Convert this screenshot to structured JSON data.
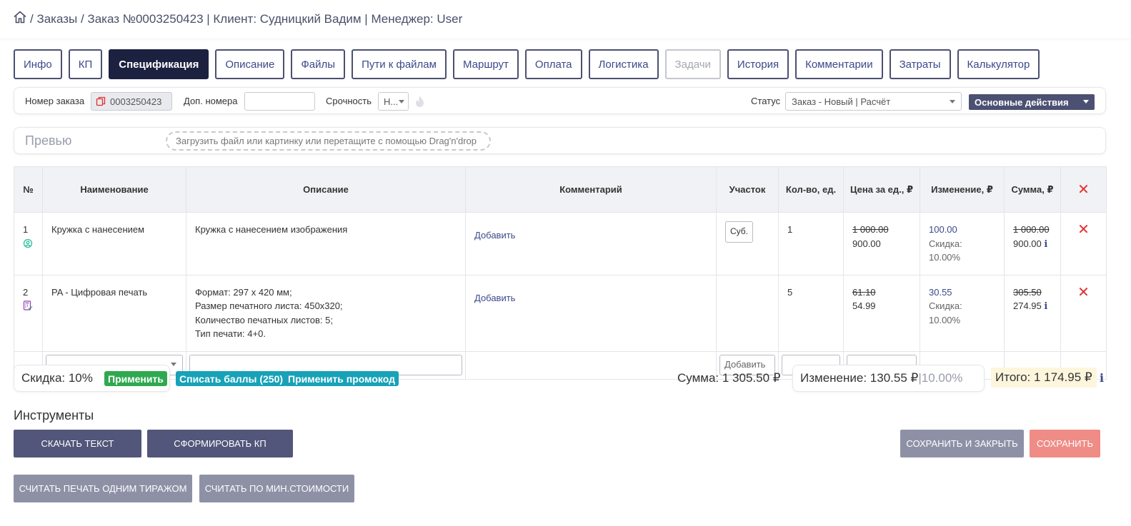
{
  "breadcrumb": {
    "text": " / Заказы / Заказ №0003250423 | Клиент: Судницкий Вадим | Менеджер: User"
  },
  "tabs": [
    {
      "label": "Инфо"
    },
    {
      "label": "КП"
    },
    {
      "label": "Спецификация"
    },
    {
      "label": "Описание"
    },
    {
      "label": "Файлы"
    },
    {
      "label": "Пути к файлам"
    },
    {
      "label": "Маршрут"
    },
    {
      "label": "Оплата"
    },
    {
      "label": "Логистика"
    },
    {
      "label": "Задачи"
    },
    {
      "label": "История"
    },
    {
      "label": "Комментарии"
    },
    {
      "label": "Затраты"
    },
    {
      "label": "Калькулятор"
    }
  ],
  "order": {
    "number_label": "Номер заказа",
    "number_value": "0003250423",
    "extra_label": "Доп. номера",
    "extra_value": "",
    "urgency_label": "Срочность",
    "urgency_value": "Н...",
    "status_label": "Статус",
    "status_value": "Заказ - Новый | Расчёт",
    "actions_label": "Основные действия"
  },
  "preview": {
    "title": "Превью",
    "dropzone": "Загрузить файл или картинку или перетащите с помощью Drag'n'drop"
  },
  "table": {
    "headers": [
      "№",
      "Наименование",
      "Описание",
      "Комментарий",
      "Участок",
      "Кол-во, ед.",
      "Цена за ед., ₽",
      "Изменение, ₽",
      "Сумма, ₽"
    ],
    "rows": [
      {
        "num": "1",
        "name": "Кружка с нанесением",
        "desc": [
          "Кружка с нанесением изображения"
        ],
        "comment": "Добавить",
        "section": "Суб.",
        "qty": "1",
        "price_old": "1 000.00",
        "price_new": "900.00",
        "change": "100.00",
        "discount": "Скидка: 10.00%",
        "sum_old": "1 000.00",
        "sum_new": "900.00"
      },
      {
        "num": "2",
        "name": "PA - Цифровая печать",
        "desc": [
          "Формат: 297 х 420 мм;",
          "Размер печатного листа: 450х320;",
          "Количество печатных листов: 5;",
          "Тип печати: 4+0."
        ],
        "comment": "Добавить",
        "section": "",
        "qty": "5",
        "price_old": "61.10",
        "price_new": "54.99",
        "change": "30.55",
        "discount": "Скидка: 10.00%",
        "sum_old": "305.50",
        "sum_new": "274.95"
      }
    ],
    "new_row": {
      "add_section": "Добавить"
    }
  },
  "summary": {
    "discount": "Скидка: 10%",
    "apply": "Применить",
    "points": "Списать баллы (250)",
    "promo": "Применить промокод",
    "sum": "Сумма: 1 305.50 ₽",
    "change": "Изменение: 130.55 ₽",
    "change_sep": " | ",
    "change_pct": "10.00%",
    "total": "Итого: 1 174.95 ₽"
  },
  "tools": {
    "title": "Инструменты",
    "download_text": "Скачать текст",
    "form_kp": "Сформировать КП",
    "print_one_run": "Считать печать одним тиражом",
    "min_cost": "Считать по мин.стоимости",
    "save_close": "Сохранить и закрыть",
    "save": "Сохранить"
  },
  "colors": {
    "accent_dark": "#1c2140",
    "link": "#3b4a8a",
    "delete": "#e03131",
    "apply_green": "#2fa84f",
    "badge_teal": "#17a2b8",
    "save_pink": "#ef8c86"
  }
}
